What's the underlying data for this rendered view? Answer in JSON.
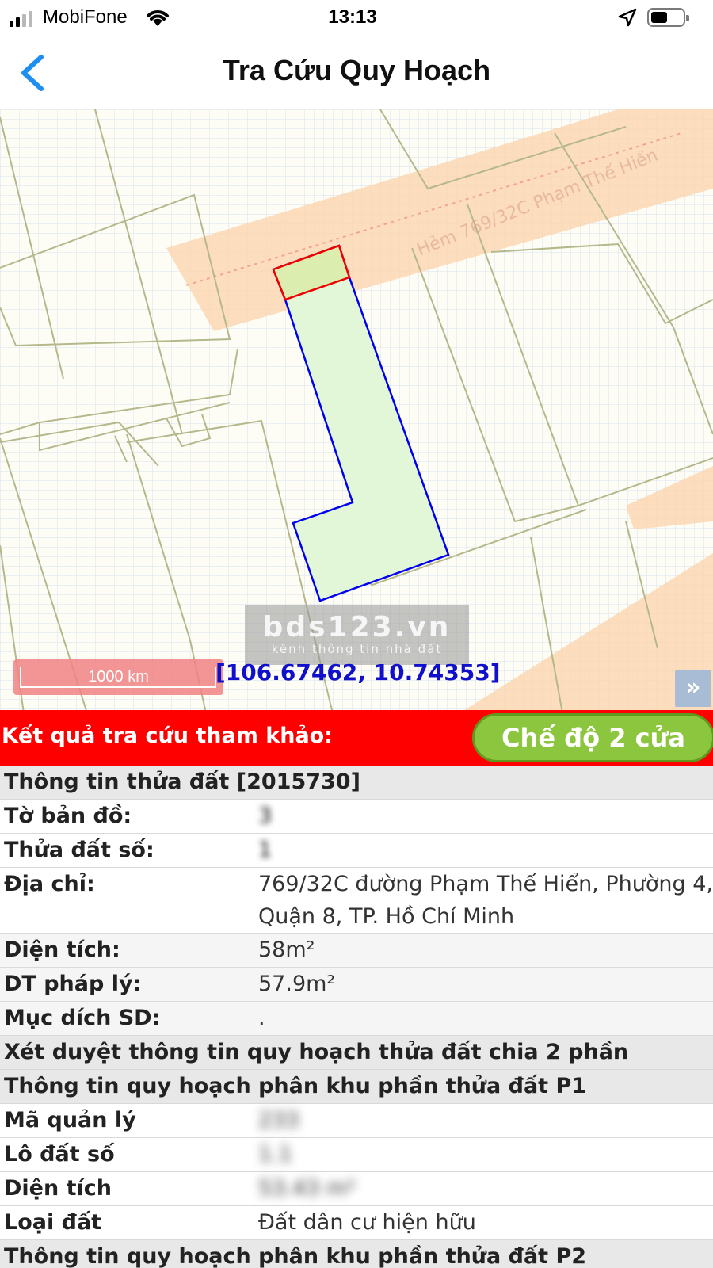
{
  "status_bar": {
    "carrier": "MobiFone",
    "time": "13:13",
    "icons": [
      "signal-icon",
      "wifi-icon",
      "location-arrow-icon",
      "battery-icon"
    ]
  },
  "nav": {
    "back_icon": "chevron-left-icon",
    "title": "Tra Cứu Quy Hoạch"
  },
  "map": {
    "watermark_title": "bds123.vn",
    "watermark_subtitle": "kênh thông tin nhà đất",
    "scale_label": "1000 km",
    "coordinates": "[106.67462, 10.74353]",
    "expand_label": "»",
    "road_label": "Hẻm 769/32C Phạm Thế Hiển",
    "colors": {
      "road": "#fbd7b3",
      "parcel_fill": "#e2f7d8",
      "parcel_border": "#0000ee",
      "plan_segment_border": "#ee0000",
      "plan_segment_fill": "#dcedb0",
      "parcel_lines": "#b5b88a",
      "grid": "#d8e1ef"
    }
  },
  "result": {
    "title": "Kết quả tra cứu tham khảo:",
    "mode_button": "Chế độ 2 cửa",
    "colors": {
      "bar": "#ff0000",
      "button": "#8cc63f"
    }
  },
  "info": {
    "parcel_header": "Thông tin thửa đất [2015730]",
    "rows": [
      {
        "label": "Tờ bản đồ:",
        "value": "3"
      },
      {
        "label": "Thửa đất số:",
        "value": "1"
      },
      {
        "label": "Địa chỉ:",
        "value": "769/32C đường Phạm Thế Hiển, Phường 4, Quận 8, TP. Hồ Chí Minh"
      },
      {
        "label": "Diện tích:",
        "value": "58m²"
      },
      {
        "label": "DT pháp lý:",
        "value": "57.9m²"
      },
      {
        "label": "Mục dích SD:",
        "value": "."
      }
    ],
    "review_header": "Xét duyệt thông tin quy hoạch thửa đất chia 2 phần",
    "p1_header": "Thông tin quy hoạch phân khu phần thửa đất P1",
    "p1_rows": [
      {
        "label": "Mã quản lý",
        "value": "233"
      },
      {
        "label": "Lô đất số",
        "value": "1.1"
      },
      {
        "label": "Diện tích",
        "value": "53.43 m²"
      },
      {
        "label": "Loại đất",
        "value": "Đất dân cư hiện hữu"
      }
    ],
    "p2_header": "Thông tin quy hoạch phân khu phần thửa đất P2"
  }
}
